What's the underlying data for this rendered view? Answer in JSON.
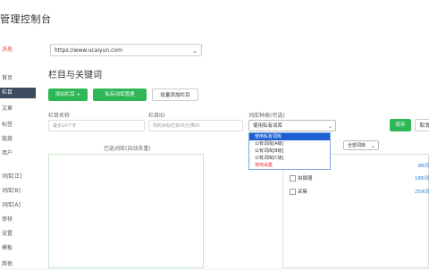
{
  "app": {
    "title": "管理控制台"
  },
  "sidebar": {
    "items": [
      {
        "label": "消息",
        "style": "red"
      },
      {
        "label": "首页",
        "style": ""
      },
      {
        "label": "栏目",
        "style": "active"
      },
      {
        "label": "文章",
        "style": ""
      },
      {
        "label": "标签",
        "style": ""
      },
      {
        "label": "链接",
        "style": ""
      },
      {
        "label": "用户",
        "style": ""
      },
      {
        "label": "词库[正]",
        "style": ""
      },
      {
        "label": "词库[B]",
        "style": ""
      },
      {
        "label": "词库[A]",
        "style": ""
      },
      {
        "label": "审核",
        "style": ""
      },
      {
        "label": "设置",
        "style": ""
      },
      {
        "label": "模板",
        "style": ""
      },
      {
        "label": "其他",
        "style": ""
      }
    ]
  },
  "site_select": {
    "value": "https://www.ucaiyun.com"
  },
  "page": {
    "title": "栏目与关键词"
  },
  "toolbar": {
    "add_label": "添加栏目 +",
    "manage_label": "私有词库管理",
    "batch_label": "批量添加栏目"
  },
  "form": {
    "name_label": "栏目名称",
    "name_placeholder": "最多10个字",
    "id_label": "栏目ID",
    "id_placeholder": "你的目标栏目ID/分类ID",
    "lib_label": "词库种类(可选)",
    "lib_value": "使用私有词库",
    "save_label": "保存",
    "cancel_label": "取消"
  },
  "dropdown": {
    "options": [
      {
        "label": "使用私有词库",
        "state": "selected"
      },
      {
        "label": "公有词库[A级]",
        "state": ""
      },
      {
        "label": "公有词库[B级]",
        "state": ""
      },
      {
        "label": "公有词库[C级]",
        "state": ""
      },
      {
        "label": "使用采集",
        "state": "red"
      }
    ]
  },
  "left_panel": {
    "caption": "已选词库(自动去重)"
  },
  "right_panel": {
    "filter_value": "全部词库",
    "rows": [
      {
        "label": "",
        "count": "98词"
      },
      {
        "label": "拍摄器",
        "count": "186词"
      },
      {
        "label": "采集",
        "count": "259词"
      }
    ]
  }
}
